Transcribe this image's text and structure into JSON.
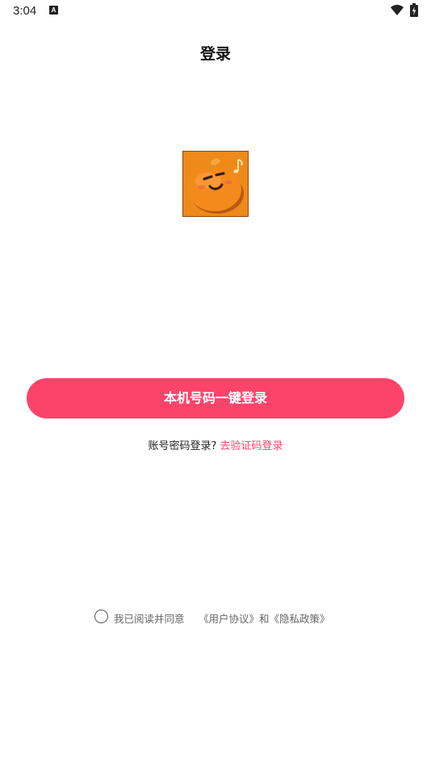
{
  "status_bar": {
    "time": "3:04",
    "notification_icon_letter": "A",
    "icons": [
      "wifi-icon",
      "battery-charging-icon"
    ]
  },
  "header": {
    "title": "登录"
  },
  "logo": {
    "icon": "orange-mascot-logo"
  },
  "login": {
    "primary_button_label": "本机号码一键登录",
    "alt_prompt": "账号密码登录?",
    "alt_link": "去验证码登录"
  },
  "agreement": {
    "checked": false,
    "text": "我已阅读并同意",
    "user_agreement": "《用户协议》",
    "conjunction": "和",
    "privacy_policy": "《隐私政策》"
  },
  "colors": {
    "accent": "#fc446a",
    "logo_background": "#ee8a1a"
  }
}
